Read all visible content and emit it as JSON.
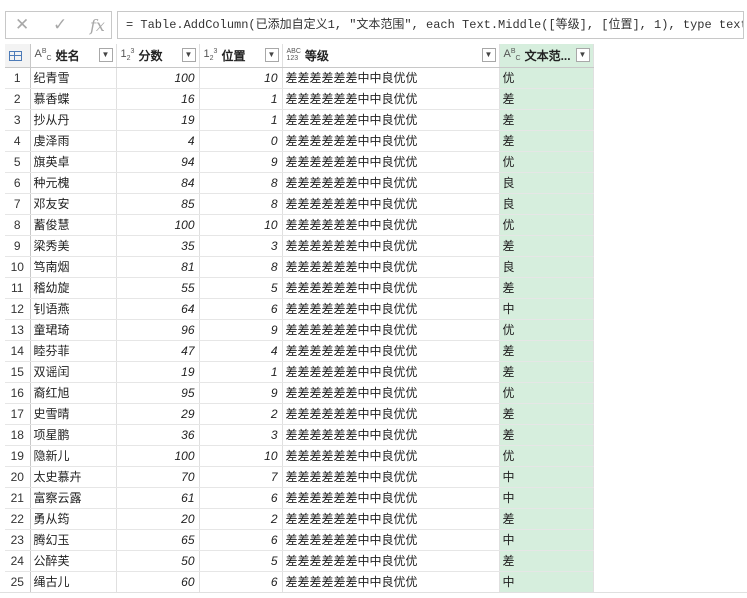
{
  "formula": {
    "cancel_icon": "✕",
    "confirm_icon": "✓",
    "fx_label": "fx",
    "text": "= Table.AddColumn(已添加自定义1, \"文本范围\", each Text.Middle([等级], [位置], 1), type text)"
  },
  "columns": [
    {
      "type_icon": "ABC",
      "name": "姓名"
    },
    {
      "type_icon": "123",
      "name": "分数"
    },
    {
      "type_icon": "123",
      "name": "位置"
    },
    {
      "type_icon": "ABC123",
      "name": "等级"
    },
    {
      "type_icon": "ABC",
      "name": "文本范..."
    }
  ],
  "rows": [
    [
      "1",
      "纪青雪",
      "100",
      "10",
      "差差差差差差中中良优优",
      "优"
    ],
    [
      "2",
      "慕香蝶",
      "16",
      "1",
      "差差差差差差中中良优优",
      "差"
    ],
    [
      "3",
      "抄从丹",
      "19",
      "1",
      "差差差差差差中中良优优",
      "差"
    ],
    [
      "4",
      "虔泽雨",
      "4",
      "0",
      "差差差差差差中中良优优",
      "差"
    ],
    [
      "5",
      "旗英卓",
      "94",
      "9",
      "差差差差差差中中良优优",
      "优"
    ],
    [
      "6",
      "种元槐",
      "84",
      "8",
      "差差差差差差中中良优优",
      "良"
    ],
    [
      "7",
      "邓友安",
      "85",
      "8",
      "差差差差差差中中良优优",
      "良"
    ],
    [
      "8",
      "蓄俊慧",
      "100",
      "10",
      "差差差差差差中中良优优",
      "优"
    ],
    [
      "9",
      "梁秀美",
      "35",
      "3",
      "差差差差差差中中良优优",
      "差"
    ],
    [
      "10",
      "笃南烟",
      "81",
      "8",
      "差差差差差差中中良优优",
      "良"
    ],
    [
      "11",
      "稽幼旋",
      "55",
      "5",
      "差差差差差差中中良优优",
      "差"
    ],
    [
      "12",
      "钊语燕",
      "64",
      "6",
      "差差差差差差中中良优优",
      "中"
    ],
    [
      "13",
      "童珺琦",
      "96",
      "9",
      "差差差差差差中中良优优",
      "优"
    ],
    [
      "14",
      "睦芬菲",
      "47",
      "4",
      "差差差差差差中中良优优",
      "差"
    ],
    [
      "15",
      "双谣闰",
      "19",
      "1",
      "差差差差差差中中良优优",
      "差"
    ],
    [
      "16",
      "裔红旭",
      "95",
      "9",
      "差差差差差差中中良优优",
      "优"
    ],
    [
      "17",
      "史雪晴",
      "29",
      "2",
      "差差差差差差中中良优优",
      "差"
    ],
    [
      "18",
      "项星鹏",
      "36",
      "3",
      "差差差差差差中中良优优",
      "差"
    ],
    [
      "19",
      "隐新儿",
      "100",
      "10",
      "差差差差差差中中良优优",
      "优"
    ],
    [
      "20",
      "太史慕卉",
      "70",
      "7",
      "差差差差差差中中良优优",
      "中"
    ],
    [
      "21",
      "富察云露",
      "61",
      "6",
      "差差差差差差中中良优优",
      "中"
    ],
    [
      "22",
      "勇从筠",
      "20",
      "2",
      "差差差差差差中中良优优",
      "差"
    ],
    [
      "23",
      "腾幻玉",
      "65",
      "6",
      "差差差差差差中中良优优",
      "中"
    ],
    [
      "24",
      "公醉芙",
      "50",
      "5",
      "差差差差差差中中良优优",
      "差"
    ],
    [
      "25",
      "绳古儿",
      "60",
      "6",
      "差差差差差差中中良优优",
      "中"
    ]
  ],
  "colors": {
    "selected_column": "#d6eedd",
    "table_icon": "#4d7bb8"
  }
}
